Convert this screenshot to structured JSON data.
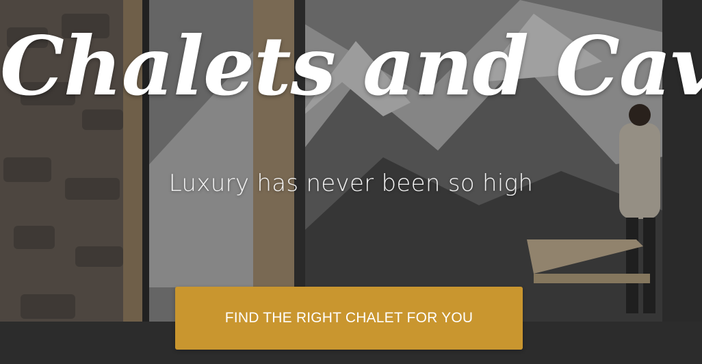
{
  "hero": {
    "title": "Chalets and Caviar",
    "subtitle": "Luxury has never been so high",
    "cta_label": "FIND THE RIGHT CHALET FOR YOU"
  },
  "colors": {
    "cta_background": "#c9962f",
    "text": "#ffffff"
  }
}
